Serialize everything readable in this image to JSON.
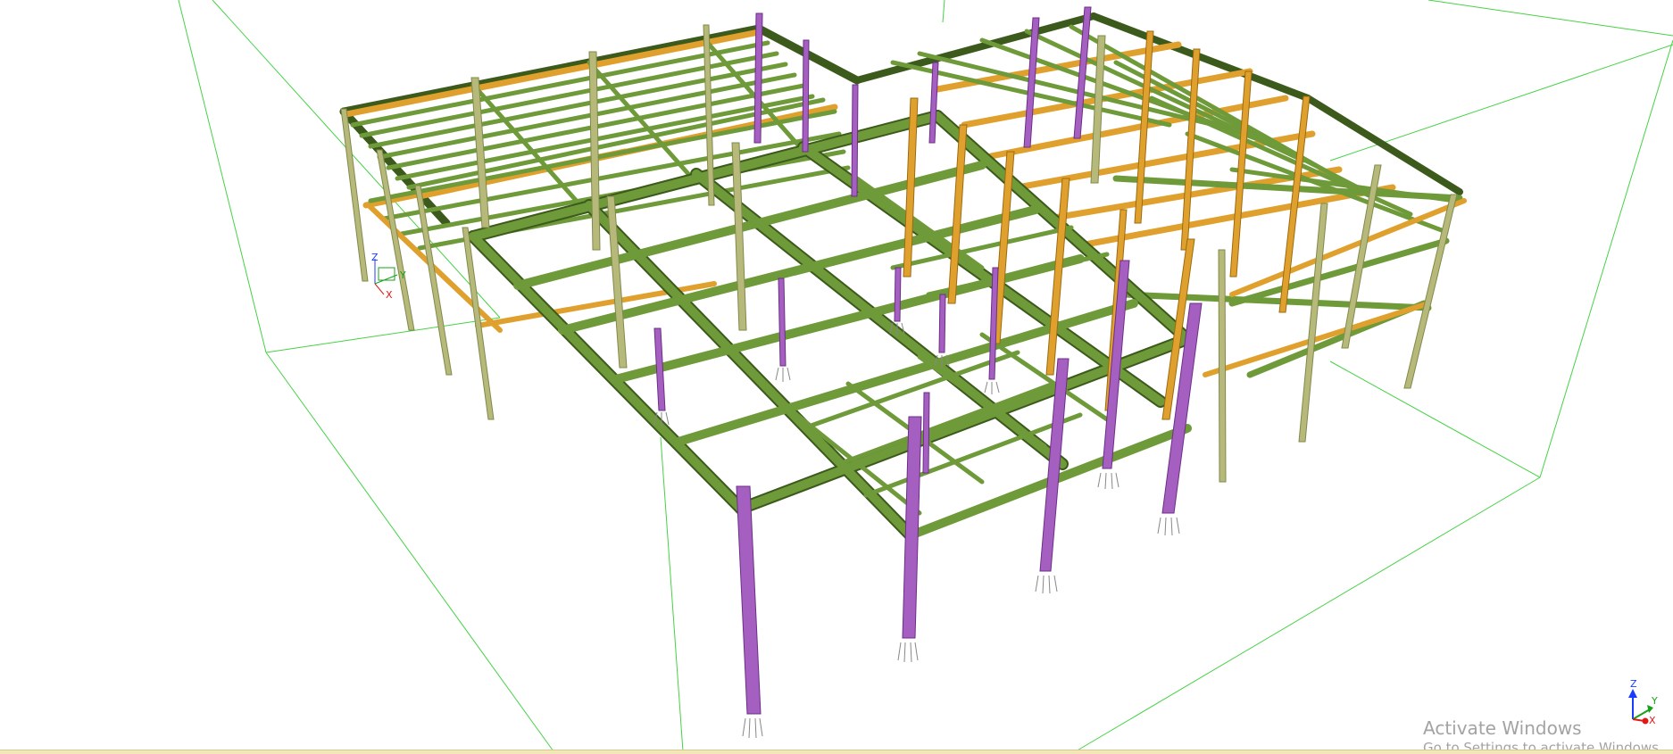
{
  "watermark": {
    "title": "Activate Windows",
    "subtitle": "Go to Settings to activate Windows."
  },
  "triad": {
    "z_label": "Z",
    "y_label": "Y",
    "x_label": "X"
  },
  "local_triad": {
    "z_label": "Z",
    "y_label": "Y",
    "x_label": "X"
  },
  "colors": {
    "beam_green": "#6f9a3a",
    "beam_dark": "#3c5a1c",
    "beam_orange": "#e0a02e",
    "column_tan": "#b7b97a",
    "column_purple": "#a45fc0",
    "column_purple_dark": "#6c2f86",
    "boundary_line": "#46d246",
    "axis_z": "#1a3cff",
    "axis_y": "#18a018",
    "axis_x": "#e01818"
  }
}
